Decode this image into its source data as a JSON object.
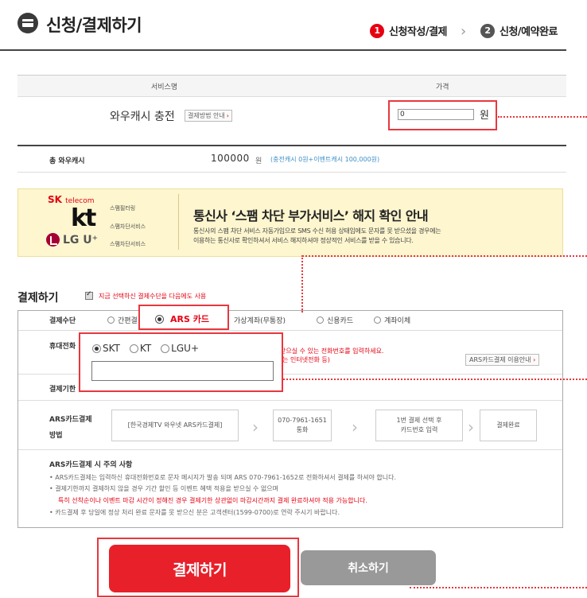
{
  "header": {
    "title": "신청/결제하기",
    "step1_num": "1",
    "step1_label": "신청작성/결제",
    "step2_num": "2",
    "step2_label": "신청/예약완료"
  },
  "service_table": {
    "col_name": "서비스명",
    "col_price": "가격",
    "service_name": "와우캐시 충전",
    "guide_button": "결제방법 안내",
    "price_value": "0",
    "price_unit": "원"
  },
  "total": {
    "label": "총 와우캐시",
    "value": "100000",
    "unit": "원",
    "detail": "(충전캐시 0원+이벤트캐시 100,000원)"
  },
  "notice": {
    "sk_logo": "SK",
    "sk_sub": "telecom",
    "kt_logo": "kt",
    "lg_logo": "LG U⁺",
    "sk_service": "스팸필터링",
    "kt_service": "스팸차단서비스",
    "lg_service": "스팸차단서비스",
    "title": "통신사 ‘스팸 차단 부가서비스’ 해지 확인 안내",
    "line1": "통신사의 스팸 차단 서비스 자동가입으로 SMS 수신 허용 상태임에도 문자를 못 받으셨을 경우에는",
    "line2": "이용하는 통신사로 확인하셔서 서비스 해지하셔야 정상적인 서비스를 받을 수 있습니다."
  },
  "payment": {
    "title": "결제하기",
    "remember_label": "지금 선택하신 결제수단을 다음에도 사용",
    "method_label": "결제수단",
    "methods": [
      "간편결",
      "ARS 카드",
      "가상계좌(무통장)",
      "신용카드",
      "계좌이체"
    ],
    "phone_label": "휴대전화",
    "phone_note_line1": "받으실 수 있는 전화번호를 입력하세요.",
    "phone_note_line2": "(는 인터넷전화 등)",
    "ars_guide": "ARS카드결제 이용안내",
    "carriers": [
      "SKT",
      "KT",
      "LGU+"
    ],
    "deadline_label": "결제기한",
    "ars_method_label1": "ARS카드결제",
    "ars_method_label2": "방법",
    "flow": [
      "[한국경제TV 와우넷 ARS카드결제]",
      "070-7961-1651",
      "통화",
      "1번 결제 선택 후",
      "카드번호 입력",
      "결제완료"
    ],
    "notes_title": "ARS카드결제 시 주의 사항",
    "notes": [
      "• ARS카드결제는 입력하신 휴대전화번호로 문자 메시지가 발송 되며 ARS 070-7961-1652로 전화하셔서 결제를 하셔야 합니다.",
      "• 결제기한까지 결제하지 않을 경우 기간 할인 등 이벤트 혜택 적용을 받으실 수 없으며",
      "특히 선착순이나 이벤트 마감 시간이 정해진 경우 결제기한 상관없이 마감시간까지 결제 완료하셔야 적용 가능합니다.",
      "• 카드결제 후 당일에 정상 처리 완료 문자를 못 받으신 분은 고객센터(1599-0700)로 연락 주시기 바랍니다."
    ]
  },
  "buttons": {
    "pay": "결제하기",
    "cancel": "취소하기"
  }
}
